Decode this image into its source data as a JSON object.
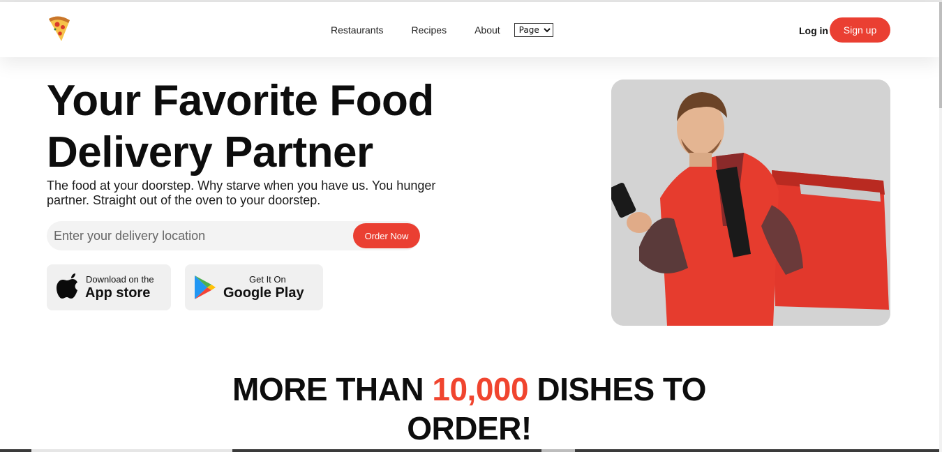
{
  "nav": {
    "links": [
      "Restaurants",
      "Recipes",
      "About"
    ],
    "page_select": "Page",
    "login_label": "Log in",
    "signup_label": "Sign up"
  },
  "hero": {
    "title": "Your Favorite Food Delivery Partner",
    "subtitle": "The food at your doorstep. Why starve when you have us. You hunger partner. Straight out of the oven to your doorstep.",
    "search_placeholder": "Enter your delivery location",
    "order_button": "Order Now",
    "image_icon": "delivery-man-photo"
  },
  "stores": {
    "apple": {
      "small": "Download on the",
      "big": "App store",
      "icon": "apple-icon"
    },
    "google": {
      "small": "Get It On",
      "big": "Google Play",
      "icon": "google-play-icon"
    }
  },
  "section": {
    "headline_before": "MORE THAN",
    "headline_accent": "10,000",
    "headline_after": "DISHES TO ORDER!"
  },
  "colors": {
    "accent": "#ea3f32",
    "headline_accent": "#f0452f",
    "store_bg": "#f0f0f0",
    "image_bg": "#d3d3d3"
  }
}
